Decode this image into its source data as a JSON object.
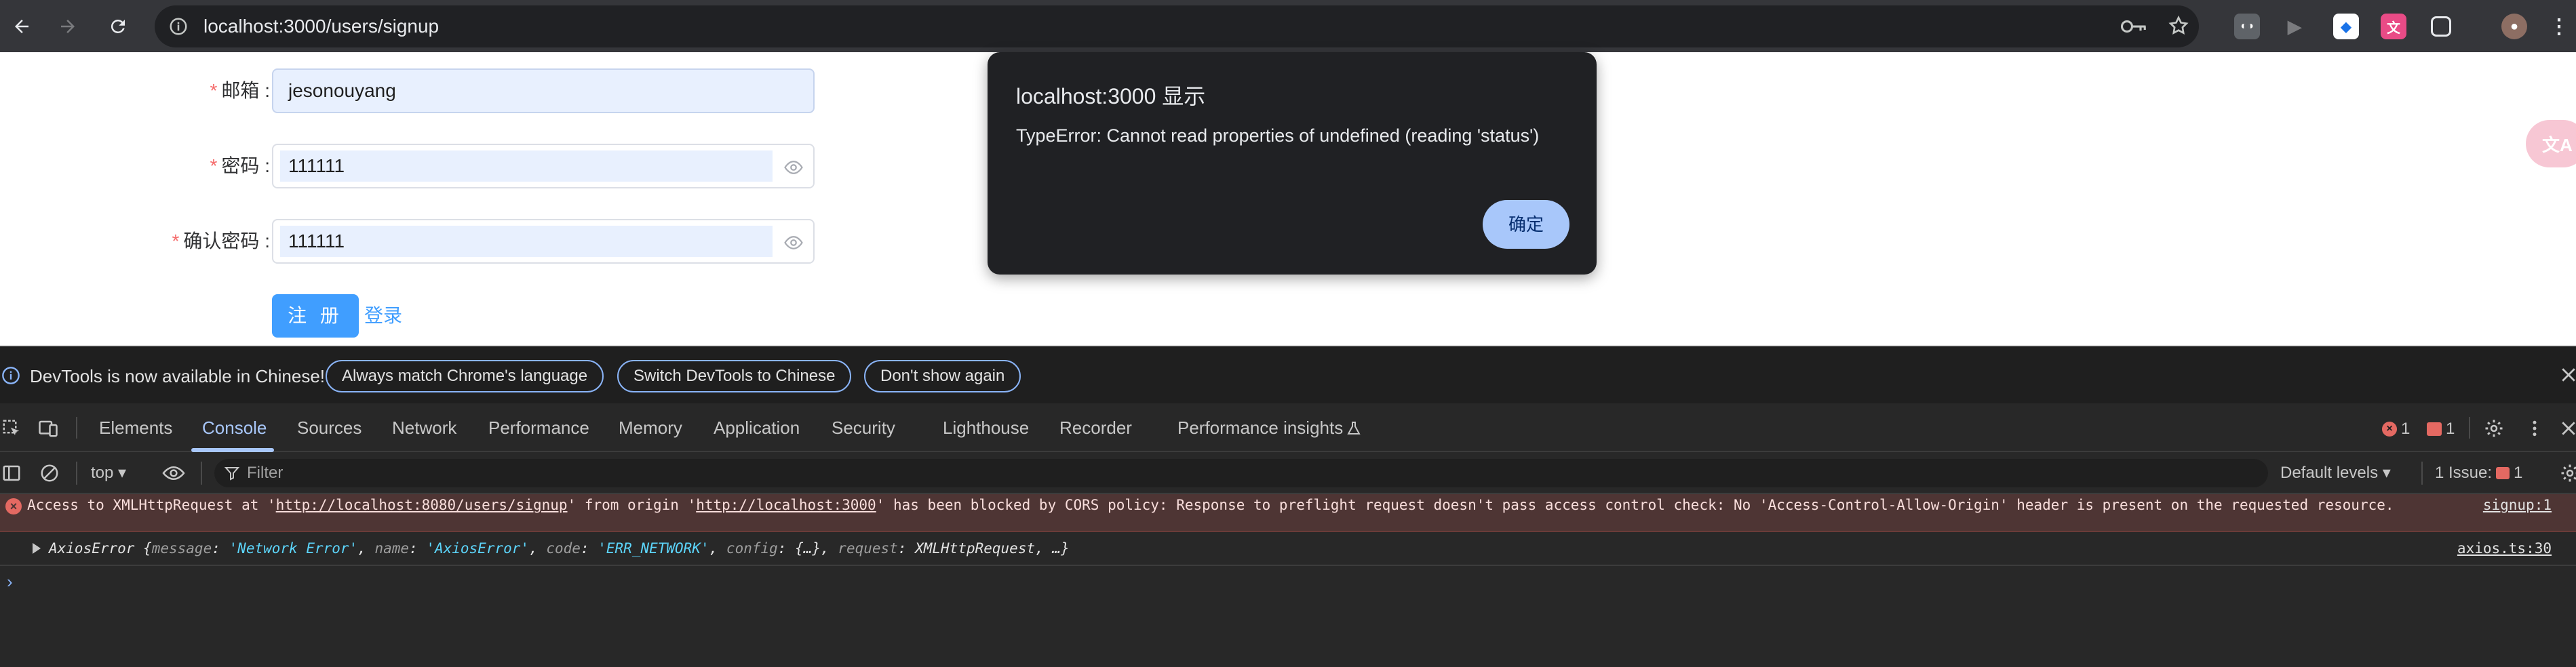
{
  "browser": {
    "url": "localhost:3000/users/signup"
  },
  "form": {
    "email_label": "邮箱",
    "email_value": "jesonouyang",
    "password_label": "密码",
    "password_value": "111111",
    "confirm_label": "确认密码",
    "confirm_value": "111111",
    "required_mark": "*",
    "colon": ":",
    "signup_label": "注 册",
    "login_label": "登录"
  },
  "alert": {
    "title": "localhost:3000 显示",
    "message": "TypeError: Cannot read properties of undefined (reading 'status')",
    "ok_label": "确定"
  },
  "devtools": {
    "notice": {
      "text": "DevTools is now available in Chinese!",
      "btn_match": "Always match Chrome's language",
      "btn_switch": "Switch DevTools to Chinese",
      "btn_dont": "Don't show again"
    },
    "tabs": {
      "elements": "Elements",
      "console": "Console",
      "sources": "Sources",
      "network": "Network",
      "performance": "Performance",
      "memory": "Memory",
      "application": "Application",
      "security": "Security",
      "lighthouse": "Lighthouse",
      "recorder": "Recorder",
      "perf_insights": "Performance insights"
    },
    "error_count": "1",
    "warning_count": "1",
    "context": "top",
    "filter_placeholder": "Filter",
    "levels": "Default levels",
    "issues_label": "1 Issue:",
    "issues_count": "1",
    "messages": {
      "error_pre": "Access to XMLHttpRequest at '",
      "error_url1": "http://localhost:8080/users/signup",
      "error_mid": "' from origin '",
      "error_url2": "http://localhost:3000",
      "error_post": "' has been blocked by CORS policy: Response to preflight request doesn't pass access control check: No 'Access-Control-Allow-Origin' header is present on the requested resource.",
      "error_source": "signup:1",
      "log_source": "axios.ts:30",
      "prompt": "›"
    }
  },
  "colors": {
    "accent": "#409eff",
    "error": "#e46962",
    "devtools_bg": "#282828",
    "alert_button": "#a8c7fa"
  }
}
